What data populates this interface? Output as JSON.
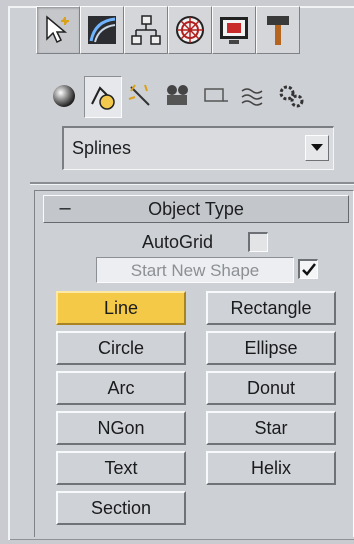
{
  "colors": {
    "panel_bg": "#cdd0d5",
    "selected_button": "#f3c947"
  },
  "command_panel_tabs": [
    {
      "icon": "create-arrow-icon",
      "active": true
    },
    {
      "icon": "modify-curve-icon",
      "active": false
    },
    {
      "icon": "hierarchy-icon",
      "active": false
    },
    {
      "icon": "motion-wheel-icon",
      "active": false
    },
    {
      "icon": "display-monitor-icon",
      "active": false
    },
    {
      "icon": "utilities-hammer-icon",
      "active": false
    }
  ],
  "create_categories": [
    {
      "icon": "geometry-sphere-icon",
      "active": false
    },
    {
      "icon": "shapes-icon",
      "active": true
    },
    {
      "icon": "lights-icon",
      "active": false
    },
    {
      "icon": "cameras-icon",
      "active": false
    },
    {
      "icon": "helpers-icon",
      "active": false
    },
    {
      "icon": "space-warps-icon",
      "active": false
    },
    {
      "icon": "systems-gear-icon",
      "active": false
    }
  ],
  "category_dropdown": {
    "value": "Splines"
  },
  "object_type": {
    "toggle_symbol": "–",
    "title": "Object Type",
    "autogrid_label": "AutoGrid",
    "autogrid_checked": false,
    "start_new_shape_label": "Start New Shape",
    "start_new_shape_checked": true,
    "buttons": [
      "Line",
      "Rectangle",
      "Circle",
      "Ellipse",
      "Arc",
      "Donut",
      "NGon",
      "Star",
      "Text",
      "Helix",
      "Section"
    ],
    "selected_button": "Line"
  }
}
